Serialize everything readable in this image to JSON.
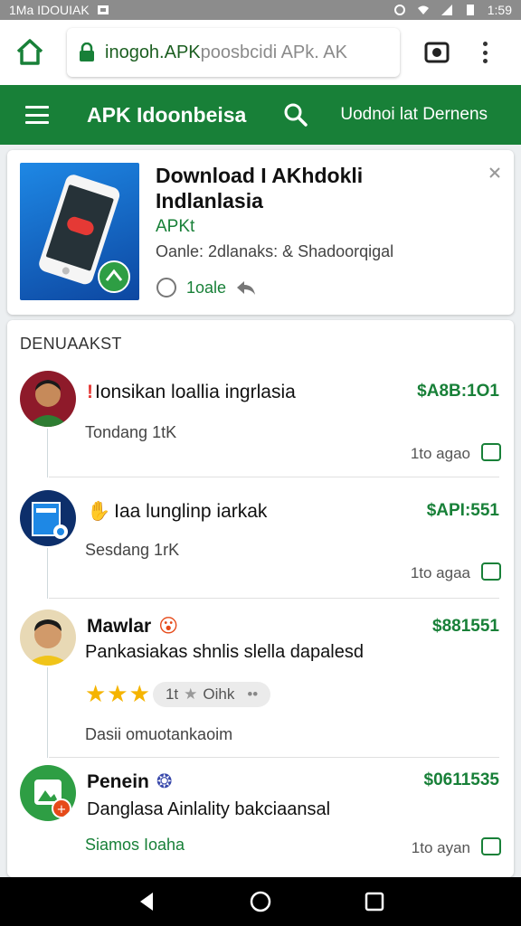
{
  "status_bar": {
    "left_text": "1Ma IDOUIAK",
    "time": "1:59"
  },
  "browser": {
    "url_host": "inogoh.APK",
    "url_rest": " poosbcidi APk. AK"
  },
  "app_bar": {
    "title": "APK Idoonbeisa",
    "right_link": "Uodnoi lat Dernens"
  },
  "featured": {
    "title": "Download I AKhdokli Indlanlasia",
    "subtitle": "APKt",
    "meta": "Oanle: 2dlanaks: & Shadoorqigal",
    "action_label": "1oale"
  },
  "list": {
    "section_title": "DENUAAKST",
    "items": [
      {
        "name": "Ionsikan loallia ingrlasia",
        "price": "$A8B:1O1",
        "sub": "Tondang 1tK",
        "time": "1to agao"
      },
      {
        "name": "Iaa lunglinp iarkak",
        "price": "$API:551",
        "sub": "Sesdang 1rK",
        "time": "1to agaa"
      },
      {
        "name": "Mawlar",
        "price": "$881551",
        "sub": "Pankasiakas shnlis slella dapalesd",
        "rating_text": "1t",
        "rating_extra": "Oihk",
        "footer": "Dasii omuotankaoim"
      },
      {
        "name": "Penein",
        "price": "$0611535",
        "sub": "Danglasa Ainlality bakciaansal",
        "footer": "Siamos Ioaha",
        "time": "1to ayan"
      }
    ]
  },
  "colors": {
    "brand_green": "#188038",
    "star": "#f5b400"
  }
}
